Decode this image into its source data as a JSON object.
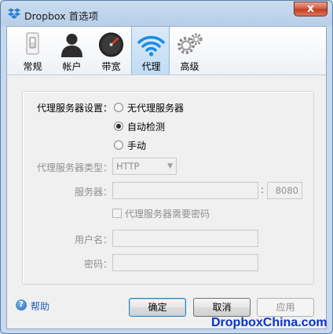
{
  "window": {
    "title": "Dropbox 首选项",
    "close_glyph": "x"
  },
  "tabs": [
    {
      "label": "常规",
      "icon": "light-switch-icon",
      "active": false
    },
    {
      "label": "帐户",
      "icon": "user-silhouette-icon",
      "active": false
    },
    {
      "label": "带宽",
      "icon": "speedometer-icon",
      "active": false
    },
    {
      "label": "代理",
      "icon": "wifi-icon",
      "active": true
    },
    {
      "label": "高级",
      "icon": "gears-icon",
      "active": false
    }
  ],
  "proxy": {
    "settings_label": "代理服务器设置：",
    "options": [
      {
        "label": "无代理服务器",
        "selected": false
      },
      {
        "label": "自动检测",
        "selected": true
      },
      {
        "label": "手动",
        "selected": false
      }
    ],
    "type_label": "代理服务器类型：",
    "type_value": "HTTP",
    "server_label": "服务器：",
    "server_value": "",
    "port_separator": ":",
    "port_value": "8080",
    "auth_checkbox_label": "代理服务器需要密码",
    "auth_checked": false,
    "username_label": "用户名：",
    "username_value": "",
    "password_label": "密码：",
    "password_value": ""
  },
  "footer": {
    "help_label": "帮助",
    "ok_label": "确定",
    "cancel_label": "取消",
    "apply_label": "应用"
  },
  "watermark": "DropboxChina.com"
}
